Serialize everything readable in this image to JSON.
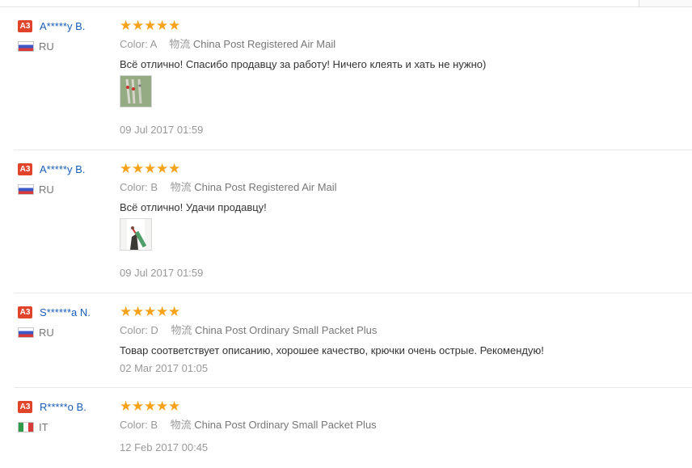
{
  "reviews": [
    {
      "badge": "A3",
      "name": "A*****y B.",
      "country": "RU",
      "flag": "ru",
      "rating": 5,
      "color_label": "Color:",
      "color_value": "A",
      "logistics_label": "物流",
      "logistics": "China Post Registered Air Mail",
      "comment": "Всё отлично! Спасибо продавцу за работу! Ничего клеять и хать не нужно)",
      "has_photo": true,
      "date": "09 Jul 2017 01:59"
    },
    {
      "badge": "A3",
      "name": "A*****y B.",
      "country": "RU",
      "flag": "ru",
      "rating": 5,
      "color_label": "Color:",
      "color_value": "B",
      "logistics_label": "物流",
      "logistics": "China Post Registered Air Mail",
      "comment": "Всё отлично! Удачи продавцу!",
      "has_photo": true,
      "date": "09 Jul 2017 01:59"
    },
    {
      "badge": "A3",
      "name": "S******a N.",
      "country": "RU",
      "flag": "ru",
      "rating": 5,
      "color_label": "Color:",
      "color_value": "D",
      "logistics_label": "物流",
      "logistics": "China Post Ordinary Small Packet Plus",
      "comment": "Товар соответствует описанию, хорошее качество, крючки очень острые. Рекомендую!",
      "has_photo": false,
      "date": "02 Mar 2017 01:05"
    },
    {
      "badge": "A3",
      "name": "R*****o B.",
      "country": "IT",
      "flag": "it",
      "rating": 5,
      "color_label": "Color:",
      "color_value": "B",
      "logistics_label": "物流",
      "logistics": "China Post Ordinary Small Packet Plus",
      "comment": "",
      "has_photo": false,
      "date": "12 Feb 2017 00:45"
    }
  ],
  "colors": {
    "star": "#f7a21b",
    "badge": "#e0452c",
    "name": "#1a5eb8"
  },
  "icons": {
    "star": "star-icon",
    "flag_ru": "flag-ru-icon",
    "flag_it": "flag-it-icon"
  }
}
